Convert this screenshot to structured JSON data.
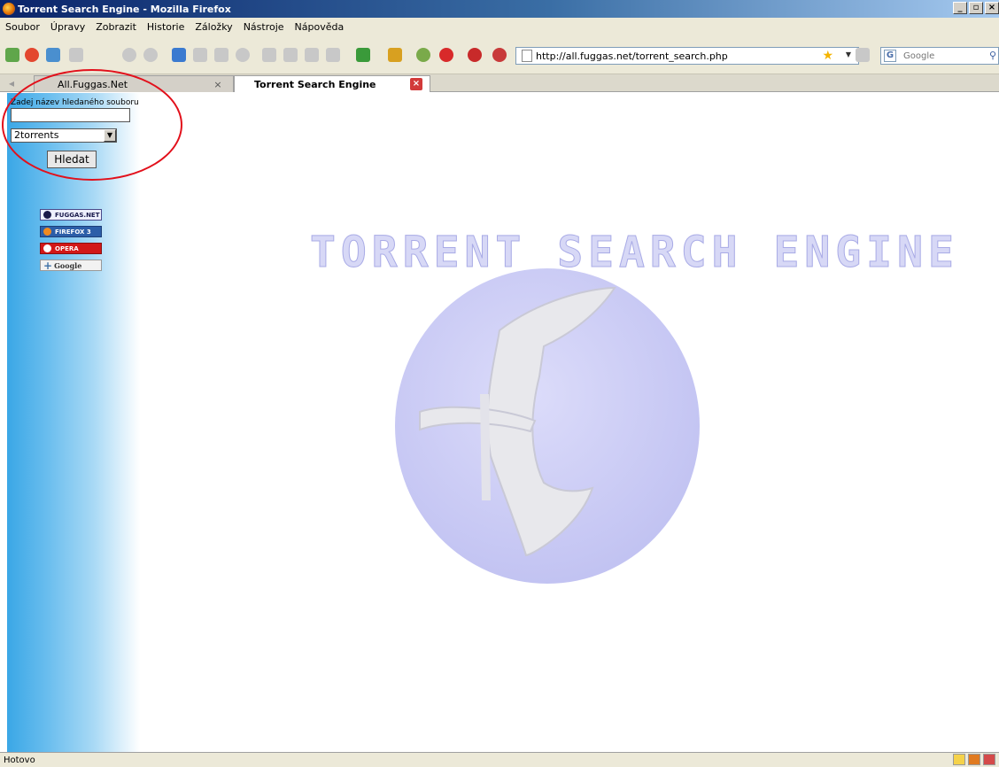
{
  "window": {
    "title": "Torrent Search Engine - Mozilla Firefox",
    "buttons": [
      "_",
      "▫",
      "×"
    ]
  },
  "menu": [
    "Soubor",
    "Úpravy",
    "Zobrazit",
    "Historie",
    "Záložky",
    "Nástroje",
    "Nápověda"
  ],
  "navbar": {
    "url": "http://all.fuggas.net/torrent_search.php",
    "search_placeholder": "Google"
  },
  "tabs": [
    {
      "label": "All.Fuggas.Net",
      "active": false
    },
    {
      "label": "Torrent Search Engine",
      "active": true
    }
  ],
  "form": {
    "label": "Zadej název hledaného souboru",
    "query": "",
    "engine_selected": "2torrents",
    "submit_label": "Hledat"
  },
  "badges": {
    "fuggas": "FUGGAS.NET",
    "firefox": "FIREFOX 3",
    "opera": "OPERA",
    "google": "Google"
  },
  "logo_text": "TORRENT SEARCH ENGINE",
  "status": {
    "text": "Hotovo"
  },
  "colors": {
    "highlight_circle": "#e2101b",
    "sidebar_gradient": "#3aa7e6",
    "emblem": "#c7c8f4"
  }
}
